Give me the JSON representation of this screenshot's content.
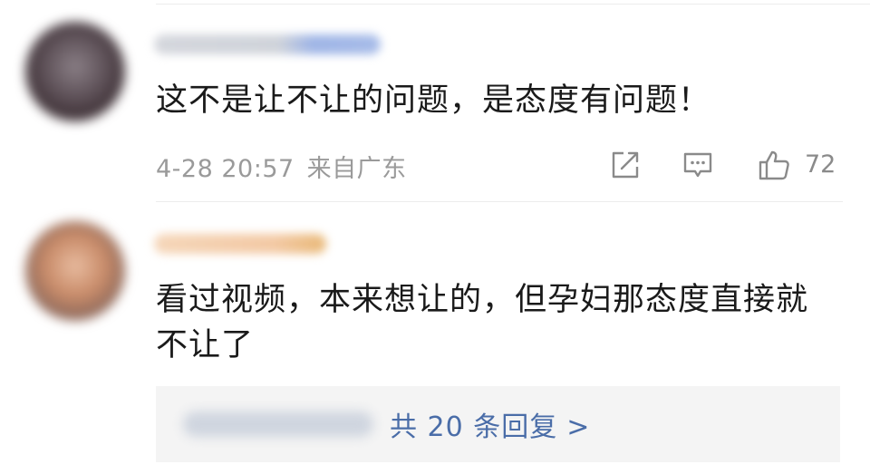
{
  "comments": [
    {
      "text": "这不是让不让的问题，是态度有问题！",
      "date": "4-28 20:57",
      "location": "来自广东",
      "like_count": "72",
      "icons": [
        "share-icon",
        "comment-icon",
        "thumbs-up-icon"
      ]
    },
    {
      "text": "看过视频，本来想让的，但孕妇那态度直接就不让了",
      "replies_label": "共 20 条回复",
      "replies_chevron": ">"
    }
  ],
  "colors": {
    "text": "#1a1a1a",
    "meta": "#9a9a9a",
    "link": "#4a6da8",
    "reply_box_bg": "#f4f4f4"
  }
}
